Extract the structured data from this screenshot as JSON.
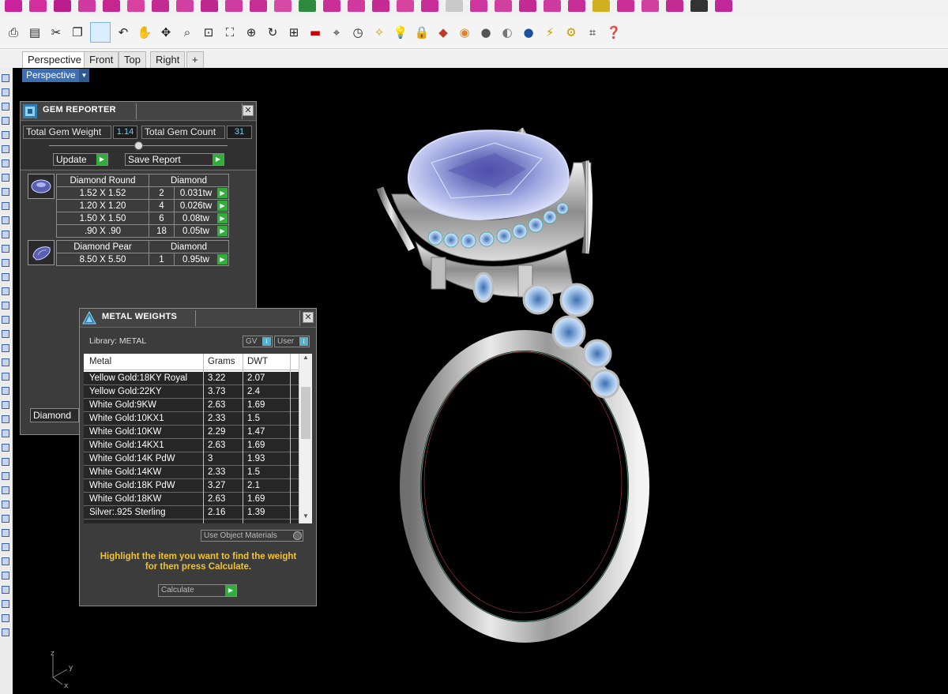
{
  "viewport": {
    "tabs": [
      "Perspective",
      "Front",
      "Top",
      "Right",
      "+"
    ],
    "active_label": "Perspective"
  },
  "gem_reporter": {
    "title": "GEM REPORTER",
    "total_weight_label": "Total Gem Weight",
    "total_weight_value": "1.14",
    "total_count_label": "Total Gem Count",
    "total_count_value": "31",
    "update_label": "Update",
    "save_report_label": "Save Report",
    "groups": [
      {
        "shape": "Diamond Round",
        "material": "Diamond",
        "rows": [
          {
            "size": "1.52 X 1.52",
            "count": "2",
            "weight": "0.031tw"
          },
          {
            "size": "1.20 X 1.20",
            "count": "4",
            "weight": "0.026tw"
          },
          {
            "size": "1.50 X 1.50",
            "count": "6",
            "weight": "0.08tw"
          },
          {
            "size": ".90 X .90",
            "count": "18",
            "weight": "0.05tw"
          }
        ]
      },
      {
        "shape": "Diamond Pear",
        "material": "Diamond",
        "rows": [
          {
            "size": "8.50 X 5.50",
            "count": "1",
            "weight": "0.95tw"
          }
        ]
      }
    ],
    "filter_value": "Diamond"
  },
  "metal_weights": {
    "title": "METAL WEIGHTS",
    "library_label": "Library: METAL",
    "gv_label": "GV",
    "user_label": "User",
    "columns": [
      "Metal",
      "Grams",
      "DWT"
    ],
    "rows": [
      [
        "Yellow Gold:18KY Royal",
        "3.22",
        "2.07"
      ],
      [
        "Yellow Gold:22KY",
        "3.73",
        "2.4"
      ],
      [
        "White Gold:9KW",
        "2.63",
        "1.69"
      ],
      [
        "White Gold:10KX1",
        "2.33",
        "1.5"
      ],
      [
        "White Gold:10KW",
        "2.29",
        "1.47"
      ],
      [
        "White Gold:14KX1",
        "2.63",
        "1.69"
      ],
      [
        "White Gold:14K PdW",
        "3",
        "1.93"
      ],
      [
        "White Gold:14KW",
        "2.33",
        "1.5"
      ],
      [
        "White Gold:18K PdW",
        "3.27",
        "2.1"
      ],
      [
        "White Gold:18KW",
        "2.63",
        "1.69"
      ],
      [
        "Silver:.925 Sterling",
        "2.16",
        "1.39"
      ]
    ],
    "use_object_materials_label": "Use Object Materials",
    "instruction_line1": "Highlight the item you want to find the weight",
    "instruction_line2": "for then press Calculate.",
    "calculate_label": "Calculate"
  },
  "colors": {
    "panel_bg": "#3c3c3c",
    "value_text": "#5dd6ff",
    "go_button": "#2fae3b",
    "instruction": "#f2c32c",
    "viewport_label": "#3f6fb3"
  }
}
